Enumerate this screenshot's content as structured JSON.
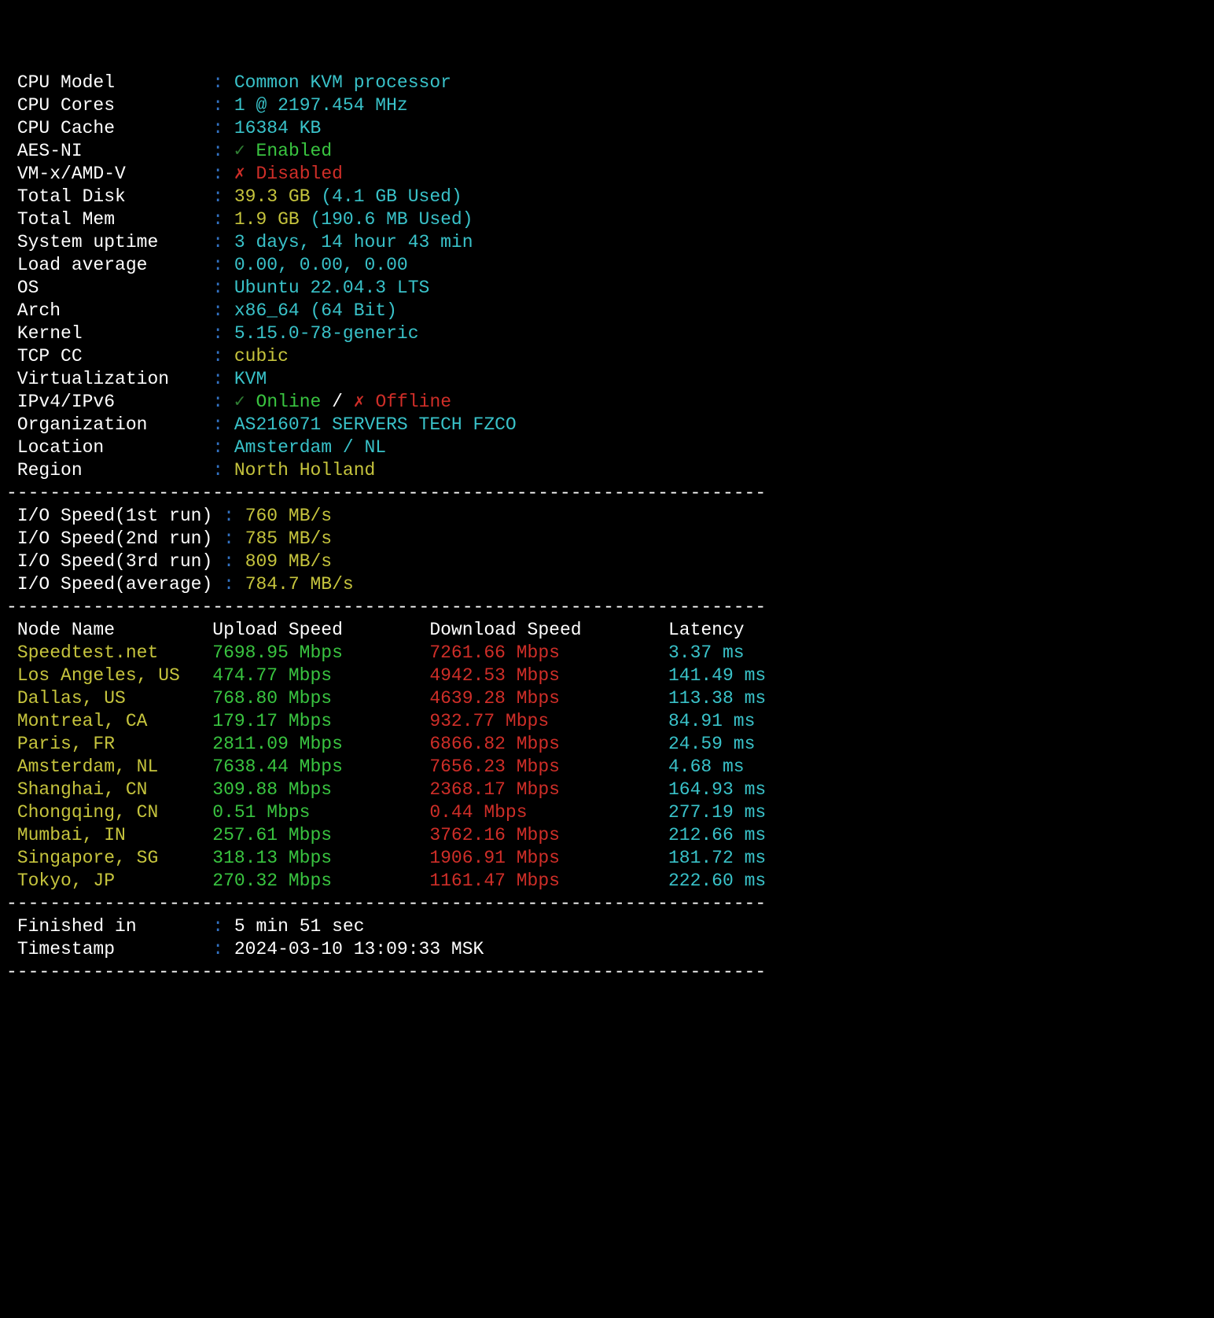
{
  "sys": {
    "cpu_model": {
      "label": "CPU Model         ",
      "value": "Common KVM processor",
      "cls": "cyan"
    },
    "cpu_cores": {
      "label": "CPU Cores         ",
      "value": "1 @ 2197.454 MHz",
      "cls": "cyan"
    },
    "cpu_cache": {
      "label": "CPU Cache         ",
      "value": "16384 KB",
      "cls": "cyan"
    },
    "aes_ni": {
      "label": "AES-NI            ",
      "mark": "✓",
      "mark_cls": "dark-green",
      "value": "Enabled",
      "cls": "green"
    },
    "vmx": {
      "label": "VM-x/AMD-V        ",
      "mark": "✗",
      "mark_cls": "red",
      "value": "Disabled",
      "cls": "red"
    },
    "disk": {
      "label": "Total Disk        ",
      "value": "39.3 GB",
      "cls": "yellow",
      "extra": " (4.1 GB Used)",
      "extra_cls": "cyan"
    },
    "mem": {
      "label": "Total Mem         ",
      "value": "1.9 GB",
      "cls": "yellow",
      "extra": " (190.6 MB Used)",
      "extra_cls": "cyan"
    },
    "uptime": {
      "label": "System uptime     ",
      "value": "3 days, 14 hour 43 min",
      "cls": "cyan"
    },
    "loadavg": {
      "label": "Load average      ",
      "value": "0.00, 0.00, 0.00",
      "cls": "cyan"
    },
    "os": {
      "label": "OS                ",
      "value": "Ubuntu 22.04.3 LTS",
      "cls": "cyan"
    },
    "arch": {
      "label": "Arch              ",
      "value": "x86_64 (64 Bit)",
      "cls": "cyan"
    },
    "kernel": {
      "label": "Kernel            ",
      "value": "5.15.0-78-generic",
      "cls": "cyan"
    },
    "tcpcc": {
      "label": "TCP CC            ",
      "value": "cubic",
      "cls": "yellow"
    },
    "virt": {
      "label": "Virtualization    ",
      "value": "KVM",
      "cls": "cyan"
    },
    "ip": {
      "label": "IPv4/IPv6         ",
      "mark1": "✓",
      "mark1_cls": "dark-green",
      "v1": "Online",
      "v1_cls": "green",
      "sep": " / ",
      "mark2": "✗",
      "mark2_cls": "red",
      "v2": "Offline",
      "v2_cls": "red"
    },
    "org": {
      "label": "Organization      ",
      "value": "AS216071 SERVERS TECH FZCO",
      "cls": "cyan"
    },
    "loc": {
      "label": "Location          ",
      "value": "Amsterdam / NL",
      "cls": "cyan"
    },
    "region": {
      "label": "Region            ",
      "value": "North Holland",
      "cls": "yellow"
    }
  },
  "io": [
    {
      "label": "I/O Speed(1st run)",
      "value": "760 MB/s"
    },
    {
      "label": "I/O Speed(2nd run)",
      "value": "785 MB/s"
    },
    {
      "label": "I/O Speed(3rd run)",
      "value": "809 MB/s"
    },
    {
      "label": "I/O Speed(average)",
      "value": "784.7 MB/s"
    }
  ],
  "speed_header": {
    "node": "Node Name",
    "up": "Upload Speed",
    "down": "Download Speed",
    "lat": "Latency"
  },
  "speed_cols": {
    "node": 18,
    "up": 20,
    "down": 22
  },
  "speed": [
    {
      "node": "Speedtest.net",
      "up": "7698.95 Mbps",
      "down": "7261.66 Mbps",
      "lat": "3.37 ms"
    },
    {
      "node": "Los Angeles, US",
      "up": "474.77 Mbps",
      "down": "4942.53 Mbps",
      "lat": "141.49 ms"
    },
    {
      "node": "Dallas, US",
      "up": "768.80 Mbps",
      "down": "4639.28 Mbps",
      "lat": "113.38 ms"
    },
    {
      "node": "Montreal, CA",
      "up": "179.17 Mbps",
      "down": "932.77 Mbps",
      "lat": "84.91 ms"
    },
    {
      "node": "Paris, FR",
      "up": "2811.09 Mbps",
      "down": "6866.82 Mbps",
      "lat": "24.59 ms"
    },
    {
      "node": "Amsterdam, NL",
      "up": "7638.44 Mbps",
      "down": "7656.23 Mbps",
      "lat": "4.68 ms"
    },
    {
      "node": "Shanghai, CN",
      "up": "309.88 Mbps",
      "down": "2368.17 Mbps",
      "lat": "164.93 ms"
    },
    {
      "node": "Chongqing, CN",
      "up": "0.51 Mbps",
      "down": "0.44 Mbps",
      "lat": "277.19 ms"
    },
    {
      "node": "Mumbai, IN",
      "up": "257.61 Mbps",
      "down": "3762.16 Mbps",
      "lat": "212.66 ms"
    },
    {
      "node": "Singapore, SG",
      "up": "318.13 Mbps",
      "down": "1906.91 Mbps",
      "lat": "181.72 ms"
    },
    {
      "node": "Tokyo, JP",
      "up": "270.32 Mbps",
      "down": "1161.47 Mbps",
      "lat": "222.60 ms"
    }
  ],
  "footer": {
    "finished": {
      "label": "Finished in       ",
      "value": "5 min 51 sec"
    },
    "timestamp": {
      "label": "Timestamp         ",
      "value": "2024-03-10 13:09:33 MSK"
    }
  },
  "divider": "----------------------------------------------------------------------"
}
